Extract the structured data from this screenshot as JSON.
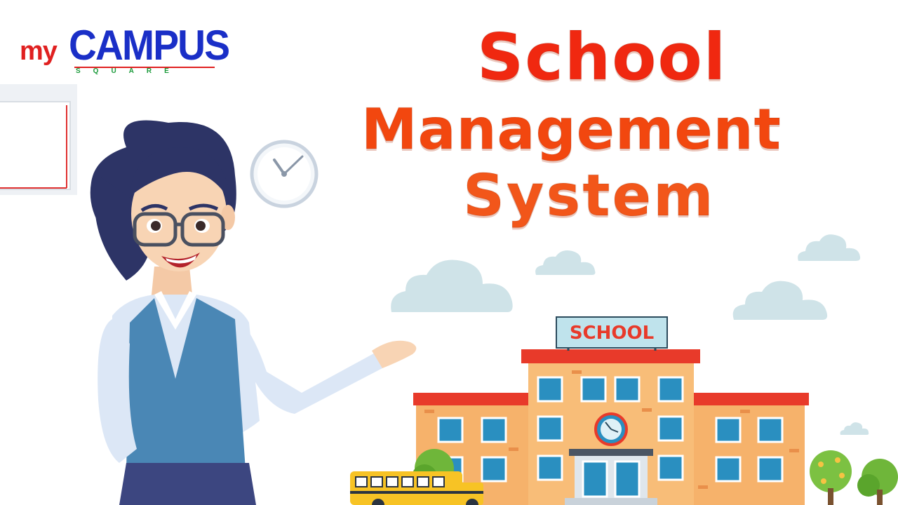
{
  "logo": {
    "my": "my",
    "campus": "CAMPUS",
    "square": "SQUARE"
  },
  "title": {
    "line1": "School",
    "line2": "Management",
    "line3": "System"
  },
  "school_sign": "SCHOOL",
  "colors": {
    "title_red": "#f02810",
    "title_orange": "#f2561a",
    "logo_blue": "#1a2fc7",
    "logo_red": "#e02020",
    "building_orange": "#f6b26b",
    "roof_red": "#e83a2a",
    "window_blue": "#2a8fc0",
    "cloud": "#cfe3e8"
  },
  "icons": [
    "clock-icon",
    "tree-icon",
    "school-bus-icon",
    "cloud-icon"
  ]
}
